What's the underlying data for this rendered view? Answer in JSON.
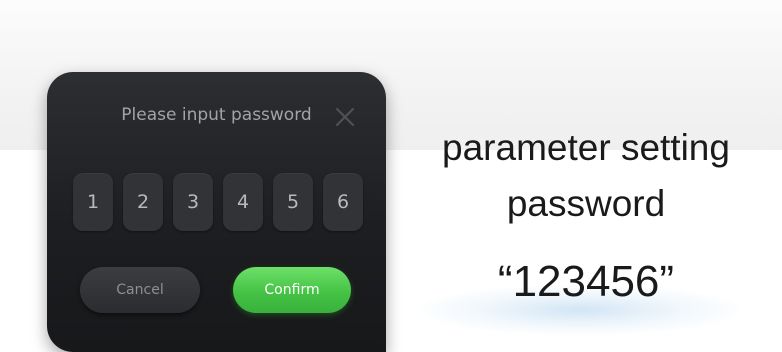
{
  "dialog": {
    "title": "Please input password",
    "close_icon": "close-x-icon",
    "digits": [
      "1",
      "2",
      "3",
      "4",
      "5",
      "6"
    ],
    "cancel_label": "Cancel",
    "confirm_label": "Confirm",
    "confirm_color": "#45c345"
  },
  "caption": {
    "line1": "parameter setting",
    "line2": "password",
    "password": "“123456”"
  }
}
